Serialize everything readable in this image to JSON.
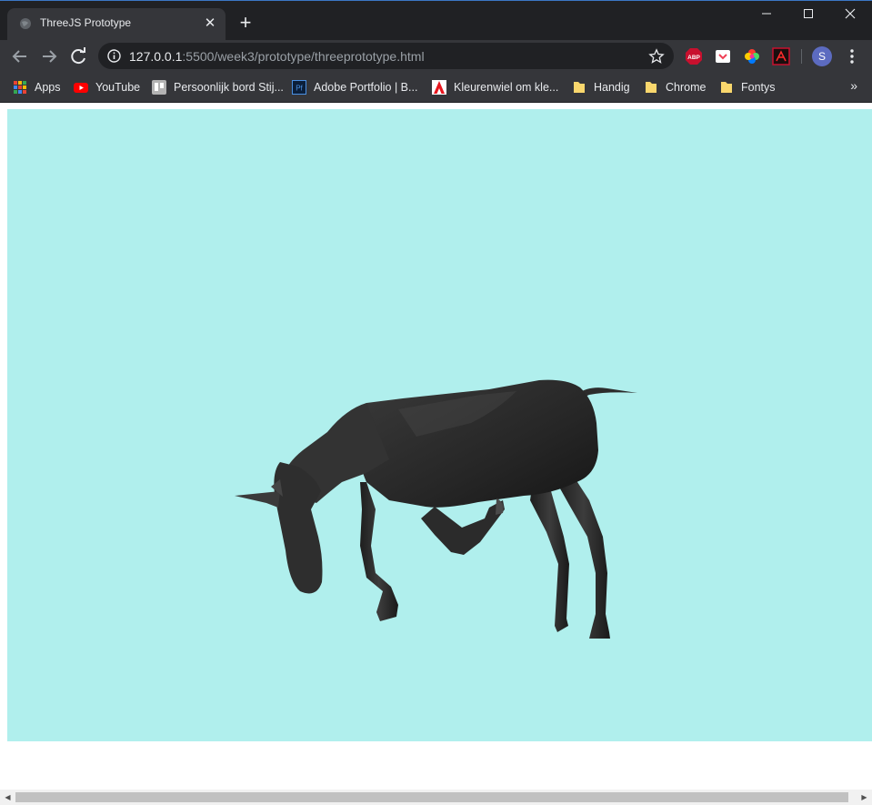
{
  "window": {
    "tab_title": "ThreeJS Prototype",
    "tab_close": "✕",
    "new_tab": "+",
    "controls": {
      "minimize": "—",
      "maximize": "☐",
      "close": "✕"
    }
  },
  "toolbar": {
    "url_host": "127.0.0.1",
    "url_rest": ":5500/week3/prototype/threeprototype.html",
    "profile_initial": "S",
    "extensions": [
      "adblock-plus-icon",
      "pocket-icon",
      "color-wheel-icon",
      "adobe-pdf-icon"
    ]
  },
  "bookmarks": {
    "items": [
      {
        "label": "Apps",
        "icon": "apps-grid-icon"
      },
      {
        "label": "YouTube",
        "icon": "youtube-icon"
      },
      {
        "label": "Persoonlijk bord Stij...",
        "icon": "trello-icon"
      },
      {
        "label": "Adobe Portfolio | B...",
        "icon": "adobe-portfolio-icon"
      },
      {
        "label": "Kleurenwiel om kle...",
        "icon": "adobe-icon"
      },
      {
        "label": "Handig",
        "icon": "folder-icon"
      },
      {
        "label": "Chrome",
        "icon": "folder-icon"
      },
      {
        "label": "Fontys",
        "icon": "folder-icon"
      }
    ],
    "more": "»"
  },
  "scene": {
    "background_color": "#b0efed",
    "model": "horse",
    "model_color": "#2a2a2a"
  }
}
